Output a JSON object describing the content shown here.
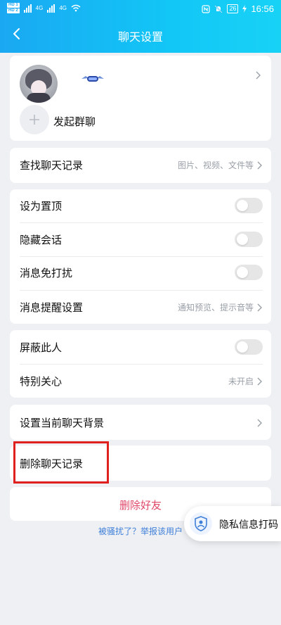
{
  "status_bar": {
    "sim1": "HD 1",
    "sim2": "HD 2",
    "net1": "4G",
    "net2": "4G",
    "battery": "26",
    "time": "16:56"
  },
  "header": {
    "title": "聊天设置"
  },
  "profile_card": {
    "add_group_label": "发起群聊"
  },
  "search_card": {
    "label": "查找聊天记录",
    "hint": "图片、视频、文件等"
  },
  "settings_card": {
    "pin": "设为置顶",
    "hide": "隐藏会话",
    "dnd": "消息免打扰",
    "reminder": "消息提醒设置",
    "reminder_hint": "通知预览、提示音等"
  },
  "privacy_card": {
    "block": "屏蔽此人",
    "special": "特别关心",
    "special_hint": "未开启"
  },
  "background_card": {
    "label": "设置当前聊天背景"
  },
  "clear_card": {
    "label": "删除聊天记录"
  },
  "delete_card": {
    "label": "删除好友"
  },
  "report_link": "被骚扰了？举报该用户",
  "privacy_float": {
    "label": "隐私信息打码"
  },
  "colors": {
    "header_start": "#1aa8f2",
    "header_end": "#18d2f6",
    "danger": "#e0496a",
    "link": "#3f7fd8",
    "highlight_box": "#e0201f"
  }
}
